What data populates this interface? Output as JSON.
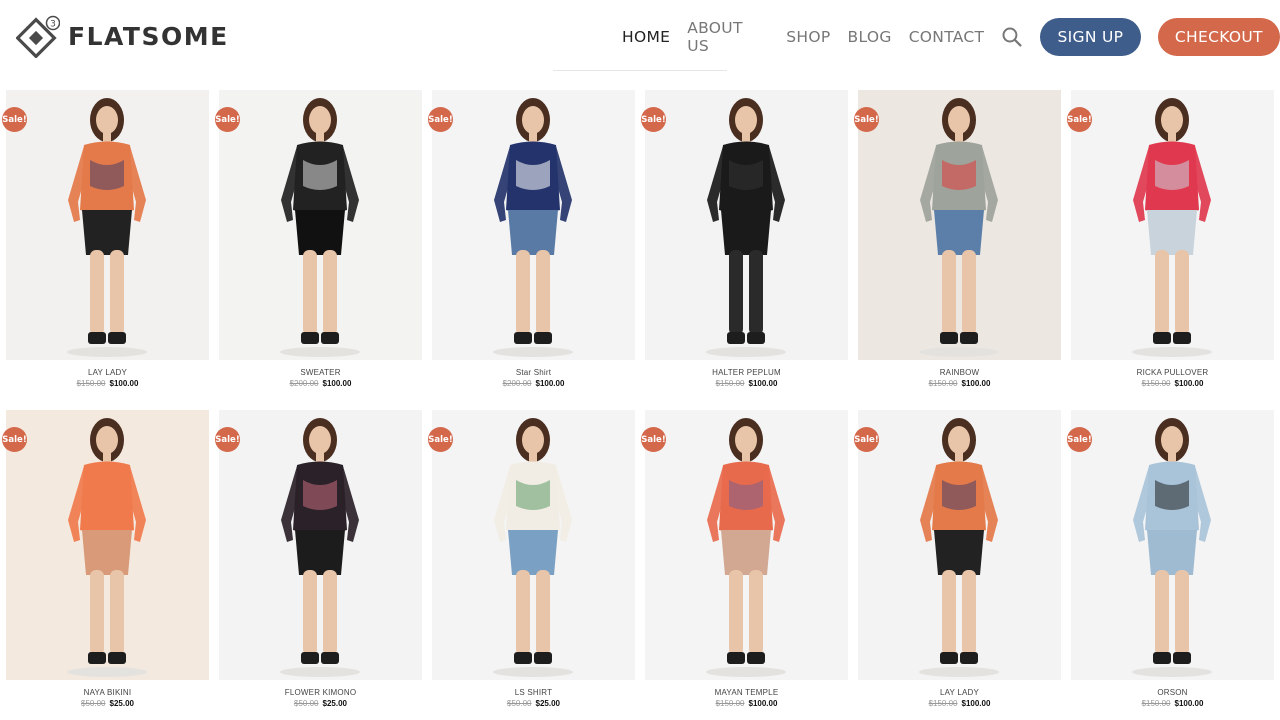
{
  "brand": {
    "name": "FLATSOME",
    "version_badge": "3"
  },
  "nav": {
    "items": [
      {
        "label": "HOME",
        "active": true
      },
      {
        "label": "ABOUT US",
        "active": false
      },
      {
        "label": "SHOP",
        "active": false
      },
      {
        "label": "BLOG",
        "active": false
      },
      {
        "label": "CONTACT",
        "active": false
      }
    ],
    "search_icon": "search-icon",
    "signup_label": "SIGN UP",
    "checkout_label": "CHECKOUT"
  },
  "colors": {
    "signup": "#3f5d8b",
    "checkout": "#d3684b",
    "sale_badge": "#d3684b"
  },
  "sale_label": "Sale!",
  "products": [
    {
      "name": "LAY LADY",
      "old_price": "$150.00",
      "price": "$100.00",
      "outfit": "patterned dress",
      "colors": [
        "#e47a4a",
        "#222",
        "#4a3f6a"
      ],
      "bg": "#f2f1ef"
    },
    {
      "name": "SWEATER",
      "old_price": "$200.00",
      "price": "$100.00",
      "outfit": "black sweater",
      "colors": [
        "#222",
        "#111",
        "#ddd"
      ],
      "bg": "#f3f3f2"
    },
    {
      "name": "Star Shirt",
      "old_price": "$200.00",
      "price": "$100.00",
      "outfit": "star sweater",
      "colors": [
        "#24336b",
        "#5a7aa6",
        "#fff"
      ],
      "bg": "#f4f4f4"
    },
    {
      "name": "HALTER PEPLUM",
      "old_price": "$150.00",
      "price": "$100.00",
      "outfit": "black peplum",
      "colors": [
        "#1a1a1a",
        "#1a1a1a",
        "#333"
      ],
      "bg": "#f3f3f3"
    },
    {
      "name": "RAINBOW",
      "old_price": "$150.00",
      "price": "$100.00",
      "outfit": "rainbow knit",
      "colors": [
        "#9ea39b",
        "#5b7fa8",
        "#e23b3b"
      ],
      "bg": "#ece7e1"
    },
    {
      "name": "RICKA PULLOVER",
      "old_price": "$150.00",
      "price": "$100.00",
      "outfit": "red pullover",
      "colors": [
        "#e0384e",
        "#c9d3dc",
        "#c9d3dc"
      ],
      "bg": "#f4f4f4"
    },
    {
      "name": "NAYA BIKINI",
      "old_price": "$50.00",
      "price": "$25.00",
      "outfit": "bikini",
      "colors": [
        "#f07a4c",
        "#d89a78",
        "#f07a4c"
      ],
      "bg": "#f4e9de"
    },
    {
      "name": "FLOWER KIMONO",
      "old_price": "$50.00",
      "price": "$25.00",
      "outfit": "floral kimono",
      "colors": [
        "#2a2228",
        "#1c1c1c",
        "#c46a7a"
      ],
      "bg": "#f3f3f3"
    },
    {
      "name": "LS SHIRT",
      "old_price": "$50.00",
      "price": "$25.00",
      "outfit": "floral shirt",
      "colors": [
        "#f1ede4",
        "#7aa0c4",
        "#5d9a68"
      ],
      "bg": "#f4f4f4"
    },
    {
      "name": "MAYAN TEMPLE",
      "old_price": "$150.00",
      "price": "$100.00",
      "outfit": "printed romper",
      "colors": [
        "#e86a4d",
        "#d2a893",
        "#7e5f8a"
      ],
      "bg": "#f4f4f4"
    },
    {
      "name": "LAY LADY",
      "old_price": "$150.00",
      "price": "$100.00",
      "outfit": "patterned dress",
      "colors": [
        "#e47a4a",
        "#222",
        "#4a3f6a"
      ],
      "bg": "#f3f3f3"
    },
    {
      "name": "ORSON",
      "old_price": "$150.00",
      "price": "$100.00",
      "outfit": "denim overalls",
      "colors": [
        "#a9c3d8",
        "#9fbbd2",
        "#222"
      ],
      "bg": "#f4f4f4"
    }
  ]
}
